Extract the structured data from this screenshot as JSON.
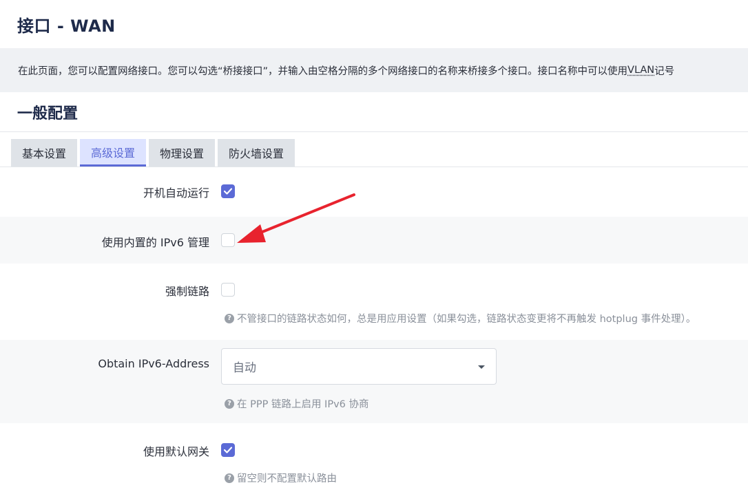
{
  "header": {
    "title": "接口 - WAN"
  },
  "description": {
    "text_before": "在此页面，您可以配置网络接口。您可以勾选“桥接接口”，并输入由空格分隔的多个网络接口的名称来桥接多个接口。接口名称中可以使用 ",
    "vlan": "VLAN",
    "text_after": " 记号"
  },
  "section": {
    "title": "一般配置"
  },
  "tabs": [
    {
      "label": "基本设置",
      "active": false
    },
    {
      "label": "高级设置",
      "active": true
    },
    {
      "label": "物理设置",
      "active": false
    },
    {
      "label": "防火墙设置",
      "active": false
    }
  ],
  "fields": {
    "auto_start": {
      "label": "开机自动运行",
      "checked": true
    },
    "builtin_ipv6": {
      "label": "使用内置的 IPv6 管理",
      "checked": false
    },
    "force_link": {
      "label": "强制链路",
      "checked": false,
      "help": "不管接口的链路状态如何，总是用应用设置（如果勾选，链路状态变更将不再触发 hotplug 事件处理）。"
    },
    "obtain_ipv6": {
      "label": "Obtain IPv6-Address",
      "value": "自动",
      "help": "在 PPP 链路上启用 IPv6 协商"
    },
    "default_gateway": {
      "label": "使用默认网关",
      "checked": true,
      "help": "留空则不配置默认路由"
    }
  },
  "colors": {
    "accent": "#5b6ad6",
    "annotation_arrow": "#e8232e"
  },
  "icons": {
    "help": "question-circle-icon",
    "checkmark": "check-icon",
    "dropdown": "caret-down-icon"
  }
}
